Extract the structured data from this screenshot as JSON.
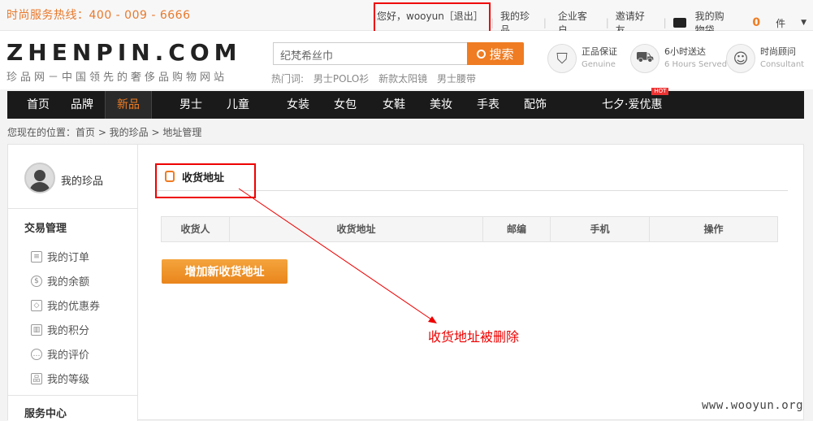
{
  "topbar": {
    "hotline": "时尚服务热线：400 - 009 - 6666",
    "greeting": "您好，wooyun［退出］",
    "links": [
      "我的珍品",
      "企业客户",
      "邀请好友"
    ],
    "cart_label": "我的购物袋",
    "cart_count": "0",
    "cart_unit": "件"
  },
  "header": {
    "logo": "ZHENPIN.COM",
    "slogan": "珍品网－中国领先的奢侈品购物网站",
    "search_value": "纪梵希丝巾",
    "search_button": "搜索",
    "hot_label": "热门词:",
    "hot_words": [
      "男士POLO衫",
      "新款太阳镜",
      "男士腰带"
    ],
    "services": [
      {
        "title": "正品保证",
        "subtitle": "Genuine",
        "icon": "shield-icon"
      },
      {
        "title": "6小时送达",
        "subtitle": "6 Hours Served",
        "icon": "car-icon"
      },
      {
        "title": "时尚顾问",
        "subtitle": "Consultant",
        "icon": "person-icon"
      }
    ]
  },
  "nav": {
    "items": [
      "首页",
      "品牌",
      "新品",
      "男士",
      "儿童",
      "女装",
      "女包",
      "女鞋",
      "美妆",
      "手表",
      "配饰",
      "七夕·爱优惠"
    ],
    "active": "新品",
    "hot_badge": "HOT"
  },
  "breadcrumb": "您现在的位置：首页 > 我的珍品 > 地址管理",
  "sidebar": {
    "profile_label": "我的珍品",
    "section1": "交易管理",
    "items": [
      "我的订单",
      "我的余额",
      "我的优惠券",
      "我的积分",
      "我的评价",
      "我的等级"
    ],
    "section2": "服务中心"
  },
  "main": {
    "title": "收货地址",
    "columns": [
      "收货人",
      "收货地址",
      "邮编",
      "手机",
      "操作"
    ],
    "add_button": "增加新收货地址"
  },
  "annotation": "收货地址被删除",
  "watermark": "www.wooyun.org",
  "colors": {
    "accent": "#ef7c22",
    "highlight": "#e00000",
    "nav_bg": "#1a1a1a"
  }
}
